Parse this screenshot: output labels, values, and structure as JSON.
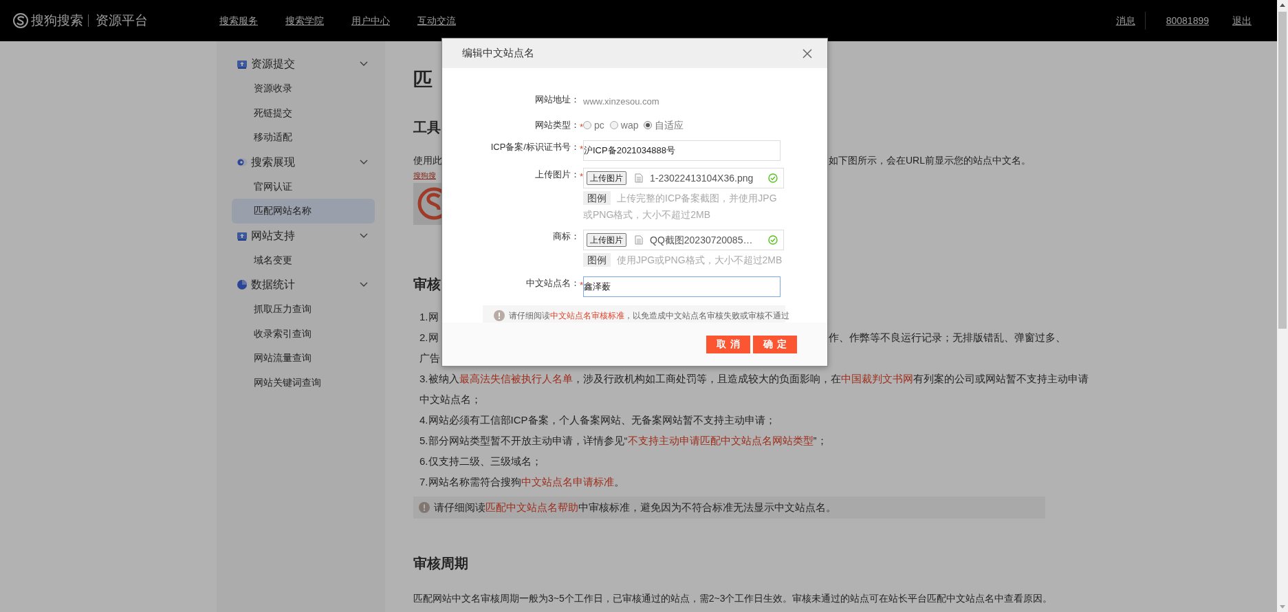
{
  "top_bar": {
    "brand": "搜狗搜索",
    "product": "资源平台",
    "nav": [
      "搜索服务",
      "搜索学院",
      "用户中心",
      "互动交流"
    ],
    "messages": "消息",
    "user_id": "80081899",
    "logout": "退出"
  },
  "sidebar": {
    "groups": [
      {
        "label": "资源提交",
        "expanded": true,
        "items": [
          {
            "label": "资源收录",
            "selected": false
          },
          {
            "label": "死链提交",
            "selected": false
          },
          {
            "label": "移动适配",
            "selected": false
          }
        ]
      },
      {
        "label": "搜索展现",
        "expanded": true,
        "items": [
          {
            "label": "官网认证",
            "selected": false
          },
          {
            "label": "匹配网站名称",
            "selected": true
          }
        ]
      },
      {
        "label": "网站支持",
        "expanded": true,
        "items": [
          {
            "label": "域名变更",
            "selected": false
          }
        ]
      },
      {
        "label": "数据统计",
        "expanded": true,
        "items": [
          {
            "label": "抓取压力查询",
            "selected": false
          },
          {
            "label": "收录索引查询",
            "selected": false
          },
          {
            "label": "网站流量查询",
            "selected": false
          },
          {
            "label": "网站关键词查询",
            "selected": false
          }
        ]
      }
    ]
  },
  "page": {
    "title": "匹",
    "section_tool": "工具",
    "intro_left": "使用此",
    "intro_right": "如下图所示，会在URL前显示您的站点中文名。",
    "example_link": "搜狗搜",
    "section_review": "审核",
    "rule_lines": [
      {
        "kind": "clipped",
        "left": "1.网"
      },
      {
        "kind": "clipped",
        "left": "2.网",
        "right": "作、作弊等不良运行记录；无排版错乱、弹窗过多、"
      },
      {
        "kind": "clipped",
        "left": "广告"
      },
      {
        "kind": "full",
        "parts": [
          {
            "text": "3.被纳入",
            "link": false
          },
          {
            "text": "最高法失信被执行人名单",
            "link": true
          },
          {
            "text": "，涉及行政机构如工商处罚等，且造成较大的负面影响，在",
            "link": false
          },
          {
            "text": "中国裁判文书网",
            "link": true
          },
          {
            "text": "有列案的公司或网站暂不支持主动申请",
            "link": false
          }
        ]
      },
      {
        "kind": "full",
        "parts": [
          {
            "text": "中文站点名；",
            "link": false
          }
        ]
      },
      {
        "kind": "full",
        "parts": [
          {
            "text": "4.网站必须有工信部ICP备案，个人备案网站、无备案网站暂不支持主动申请；",
            "link": false
          }
        ]
      },
      {
        "kind": "full",
        "parts": [
          {
            "text": "5.部分网站类型暂不开放主动申请，详情参见“",
            "link": false
          },
          {
            "text": "不支持主动申请匹配中文站点名网站类型",
            "link": true
          },
          {
            "text": "”；",
            "link": false
          }
        ]
      },
      {
        "kind": "full",
        "parts": [
          {
            "text": "6.仅支持二级、三级域名；",
            "link": false
          }
        ]
      },
      {
        "kind": "full",
        "parts": [
          {
            "text": "7.网站名称需符合搜狗",
            "link": false
          },
          {
            "text": "中文站点名申请标准",
            "link": true
          },
          {
            "text": "。",
            "link": false
          }
        ]
      }
    ],
    "tip": [
      {
        "text": "请仔细阅读",
        "link": false
      },
      {
        "text": "匹配中文站点名帮助",
        "link": true
      },
      {
        "text": "中审核标准，避免因为不符合标准无法显示中文站点名。",
        "link": false
      }
    ],
    "cycle_heading": "审核周期",
    "cycle_text": "匹配网站中文名审核周期一般为3~5个工作日，已审核通过的站点，需2~3个工作日生效。审核未通过的站点可在站长平台匹配中文站点名中查看原因。"
  },
  "dialog": {
    "title": "编辑中文站点名",
    "fields": [
      {
        "kind": "static",
        "label": "网站地址：",
        "value": "www.xinzesou.com"
      },
      {
        "kind": "radio",
        "label": "网站类型：",
        "required_mark": "*",
        "options": [
          {
            "label": "pc",
            "selected": false
          },
          {
            "label": "wap",
            "selected": false
          },
          {
            "label": "自适应",
            "selected": true
          }
        ]
      },
      {
        "kind": "input",
        "label": "ICP备案/标识证书号：",
        "required_mark": "*",
        "value": "沪ICP备2021034888号",
        "focused": false
      },
      {
        "kind": "upload",
        "label": "上传图片：",
        "required_mark": "*",
        "button": "上传图片",
        "file_name": "1-23022413104X36.png",
        "uploaded": true,
        "hint_tag": "图例",
        "hint": "上传完整的ICP备案截图，并使用JPG或PNG格式，大小不超过2MB"
      },
      {
        "kind": "upload",
        "label": "商标：",
        "button": "上传图片",
        "file_name": "QQ截图20230720085…",
        "uploaded": true,
        "hint_tag": "图例",
        "hint": "使用JPG或PNG格式，大小不超过2MB"
      },
      {
        "kind": "input",
        "label": "中文站点名：",
        "required_mark": "*",
        "value": "鑫泽薮",
        "focused": true
      }
    ],
    "notice": [
      {
        "text": "请仔细阅读",
        "link": false
      },
      {
        "text": "中文站点名审核标准",
        "link": true
      },
      {
        "text": "，以免造成中文站点名审核失败或审核不通过",
        "link": false
      }
    ],
    "buttons": [
      "取消",
      "确定"
    ]
  }
}
